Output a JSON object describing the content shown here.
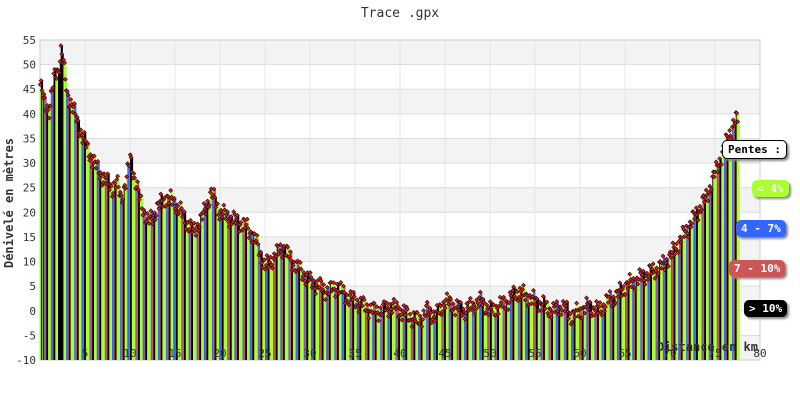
{
  "chart_data": {
    "type": "bar",
    "title": "Trace .gpx",
    "xlabel": "Distance en km",
    "ylabel": "Dénivelé en mètres",
    "xlim": [
      0,
      80
    ],
    "ylim": [
      -10,
      55
    ],
    "x_ticks": [
      "5",
      "10",
      "15",
      "20",
      "25",
      "30",
      "35",
      "40",
      "45",
      "50",
      "55",
      "60",
      "65",
      "70",
      "75",
      "80"
    ],
    "y_ticks": [
      "-10",
      "-5",
      "0",
      "5",
      "10",
      "15",
      "20",
      "25",
      "30",
      "35",
      "40",
      "45",
      "50",
      "55"
    ],
    "grid": true,
    "legend_placement": "right",
    "legend": {
      "title": "Pentes :",
      "items": [
        {
          "label": "< 4%",
          "color": "#aaff33"
        },
        {
          "label": "4 - 7%",
          "color": "#3366ff"
        },
        {
          "label": "7 - 10%",
          "color": "#cc5555"
        },
        {
          "label": "> 10%",
          "color": "#000000"
        }
      ]
    },
    "profile": [
      [
        0,
        46
      ],
      [
        0.5,
        42
      ],
      [
        1,
        41
      ],
      [
        1.5,
        47
      ],
      [
        2,
        49
      ],
      [
        2.3,
        53
      ],
      [
        2.6,
        50
      ],
      [
        3,
        44
      ],
      [
        3.5,
        42
      ],
      [
        4,
        39
      ],
      [
        5,
        34
      ],
      [
        6,
        30
      ],
      [
        7,
        27
      ],
      [
        8,
        25
      ],
      [
        8.5,
        26
      ],
      [
        9,
        23
      ],
      [
        9.5,
        26
      ],
      [
        10,
        31
      ],
      [
        10.5,
        27
      ],
      [
        11,
        23
      ],
      [
        12,
        18
      ],
      [
        12.5,
        19
      ],
      [
        13,
        21
      ],
      [
        14,
        23
      ],
      [
        15,
        22
      ],
      [
        16,
        19
      ],
      [
        17,
        16
      ],
      [
        18,
        19
      ],
      [
        19,
        24
      ],
      [
        19.5,
        22
      ],
      [
        20,
        20
      ],
      [
        21,
        19
      ],
      [
        22,
        18
      ],
      [
        23,
        17
      ],
      [
        24,
        14
      ],
      [
        25,
        9
      ],
      [
        26,
        11
      ],
      [
        27,
        13
      ],
      [
        28,
        10
      ],
      [
        29,
        8
      ],
      [
        30,
        6
      ],
      [
        31,
        5
      ],
      [
        32,
        4
      ],
      [
        33,
        5
      ],
      [
        34,
        3
      ],
      [
        35,
        2
      ],
      [
        36,
        1
      ],
      [
        37,
        0
      ],
      [
        38,
        0
      ],
      [
        39,
        1
      ],
      [
        40,
        0
      ],
      [
        41,
        -1
      ],
      [
        42,
        -2
      ],
      [
        43,
        0
      ],
      [
        44,
        -1
      ],
      [
        45,
        2
      ],
      [
        46,
        1
      ],
      [
        47,
        0
      ],
      [
        48,
        1
      ],
      [
        49,
        2
      ],
      [
        50,
        0
      ],
      [
        51,
        1
      ],
      [
        52,
        2
      ],
      [
        53,
        4
      ],
      [
        54,
        3
      ],
      [
        55,
        2
      ],
      [
        56,
        1
      ],
      [
        57,
        0
      ],
      [
        58,
        1
      ],
      [
        59,
        -1
      ],
      [
        60,
        0
      ],
      [
        61,
        1
      ],
      [
        62,
        0
      ],
      [
        63,
        2
      ],
      [
        64,
        3
      ],
      [
        65,
        5
      ],
      [
        66,
        6
      ],
      [
        67,
        7
      ],
      [
        68,
        8
      ],
      [
        69,
        9
      ],
      [
        70,
        11
      ],
      [
        71,
        14
      ],
      [
        72,
        17
      ],
      [
        73,
        20
      ],
      [
        74,
        23
      ],
      [
        75,
        28
      ],
      [
        76,
        33
      ],
      [
        77,
        38
      ],
      [
        77.5,
        39
      ]
    ]
  }
}
